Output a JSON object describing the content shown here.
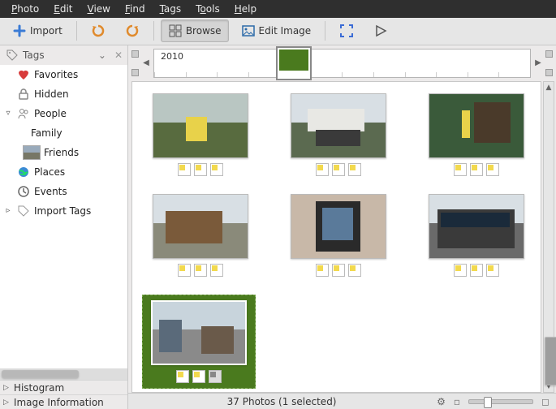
{
  "menu": [
    "Photo",
    "Edit",
    "View",
    "Find",
    "Tags",
    "Tools",
    "Help"
  ],
  "toolbar": {
    "import": "Import",
    "browse": "Browse",
    "edit_image": "Edit Image"
  },
  "sidebar": {
    "header": "Tags",
    "items": [
      {
        "label": "Favorites"
      },
      {
        "label": "Hidden"
      },
      {
        "label": "People"
      },
      {
        "label": "Family"
      },
      {
        "label": "Friends"
      },
      {
        "label": "Places"
      },
      {
        "label": "Events"
      },
      {
        "label": "Import Tags"
      }
    ],
    "sections": [
      "Histogram",
      "Image Information"
    ]
  },
  "timeline": {
    "year": "2010"
  },
  "gallery": {
    "count": 7,
    "selected_index": 6
  },
  "status": {
    "text": "37 Photos (1 selected)"
  }
}
